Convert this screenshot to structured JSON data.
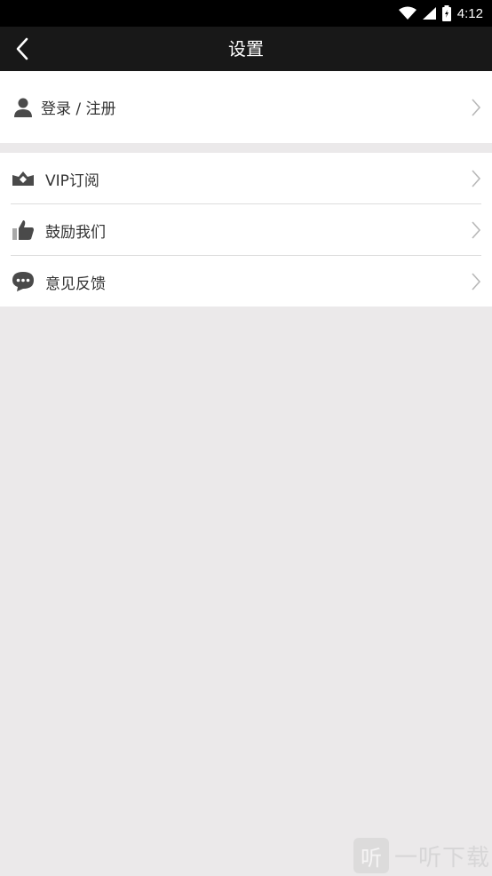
{
  "status": {
    "time": "4:12"
  },
  "header": {
    "title": "设置"
  },
  "account": {
    "login_label": "登录 / 注册"
  },
  "menu": [
    {
      "label": "VIP订阅",
      "icon": "vip-crown-icon"
    },
    {
      "label": "鼓励我们",
      "icon": "thumbs-up-icon"
    },
    {
      "label": "意见反馈",
      "icon": "chat-bubble-icon"
    }
  ],
  "watermark": {
    "logo_char": "听",
    "text": "一听下载"
  },
  "colors": {
    "topbar": "#181818",
    "background": "#ebe9ea",
    "icon": "#4a4a4a"
  }
}
